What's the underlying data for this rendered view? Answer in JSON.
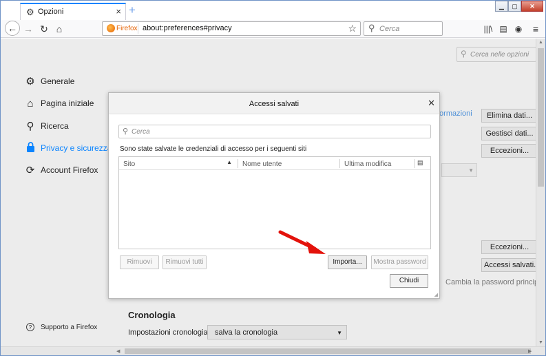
{
  "browser": {
    "tab_title": "Opzioni",
    "url_brand": "Firefox",
    "url": "about:preferences#privacy",
    "search_placeholder": "Cerca"
  },
  "prefs": {
    "search_placeholder": "Cerca nelle opzioni",
    "nav": [
      {
        "label": "Generale",
        "icon": "gear-icon",
        "active": false
      },
      {
        "label": "Pagina iniziale",
        "icon": "home-icon",
        "active": false
      },
      {
        "label": "Ricerca",
        "icon": "search-icon",
        "active": false
      },
      {
        "label": "Privacy e sicurezza",
        "icon": "lock-icon",
        "active": true
      },
      {
        "label": "Account Firefox",
        "icon": "sync-icon",
        "active": false
      }
    ],
    "support_label": "Supporto a Firefox",
    "info_link": "formazioni",
    "buttons": {
      "clear_data": "Elimina dati...",
      "manage_data": "Gestisci dati...",
      "exceptions_1": "Eccezioni...",
      "exceptions_2": "Eccezioni...",
      "saved_logins": "Accessi salvati..."
    },
    "change_password": "Cambia la password principale",
    "history_title": "Cronologia",
    "history_label": "Impostazioni cronologia:",
    "history_value": "salva la cronologia"
  },
  "dialog": {
    "title": "Accessi salvati",
    "search_placeholder": "Cerca",
    "description": "Sono state salvate le credenziali di accesso per i seguenti siti",
    "columns": [
      "Sito",
      "Nome utente",
      "Ultima modifica"
    ],
    "rows": [],
    "buttons": {
      "remove": "Rimuovi",
      "remove_all": "Rimuovi tutti",
      "import": "Importa...",
      "show_passwords": "Mostra password",
      "close": "Chiudi"
    }
  },
  "colors": {
    "accent": "#0a84ff",
    "annotation_arrow": "#e3120b"
  }
}
